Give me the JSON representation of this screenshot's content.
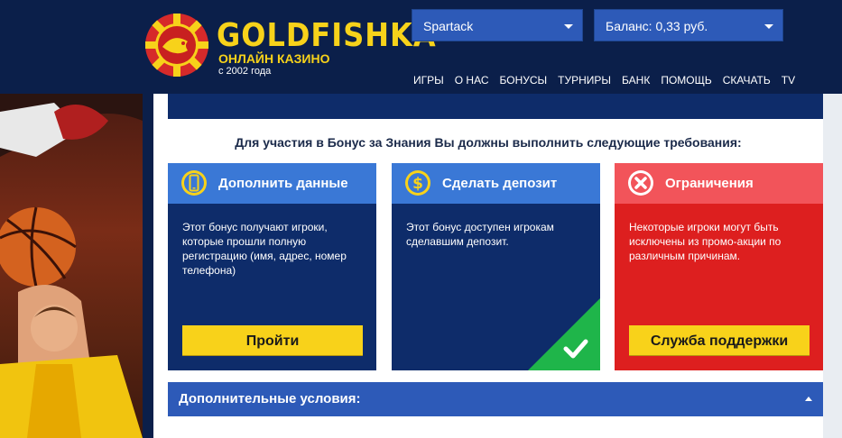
{
  "header": {
    "logo_title": "GOLDFISHKA",
    "logo_subtitle": "ОНЛАЙН КАЗИНО",
    "logo_since": "с 2002 года",
    "user_dropdown": "Spartack",
    "balance_dropdown": "Баланс: 0,33 руб.",
    "nav": [
      "ИГРЫ",
      "О НАС",
      "БОНУСЫ",
      "ТУРНИРЫ",
      "БАНК",
      "ПОМОЩЬ",
      "СКАЧАТЬ",
      "TV"
    ]
  },
  "main": {
    "requirements_title": "Для участия в Бонус за Знания Вы должны выполнить следующие требования:",
    "cards": [
      {
        "title": "Дополнить данные",
        "icon": "phone-icon",
        "text": "Этот бонус получают игроки, которые прошли полную регистрацию (имя, адрес, номер телефона)",
        "button": "Пройти"
      },
      {
        "title": "Сделать депозит",
        "icon": "dollar-icon",
        "text": "Этот бонус доступен игрокам сделавшим депозит.",
        "status_icon": "check-icon"
      },
      {
        "title": "Ограничения",
        "icon": "close-circle-icon",
        "text": "Некоторые игроки могут быть исключены из промо-акции по различным причинам.",
        "button": "Служба поддержки"
      }
    ],
    "extra_conditions": "Дополнительные условия:"
  },
  "colors": {
    "navy": "#0b1f4a",
    "blue": "#3a78d6",
    "dark_blue": "#0e2c6a",
    "red": "#dd1f1f",
    "yellow": "#f8d21a",
    "green": "#1fb54a"
  }
}
